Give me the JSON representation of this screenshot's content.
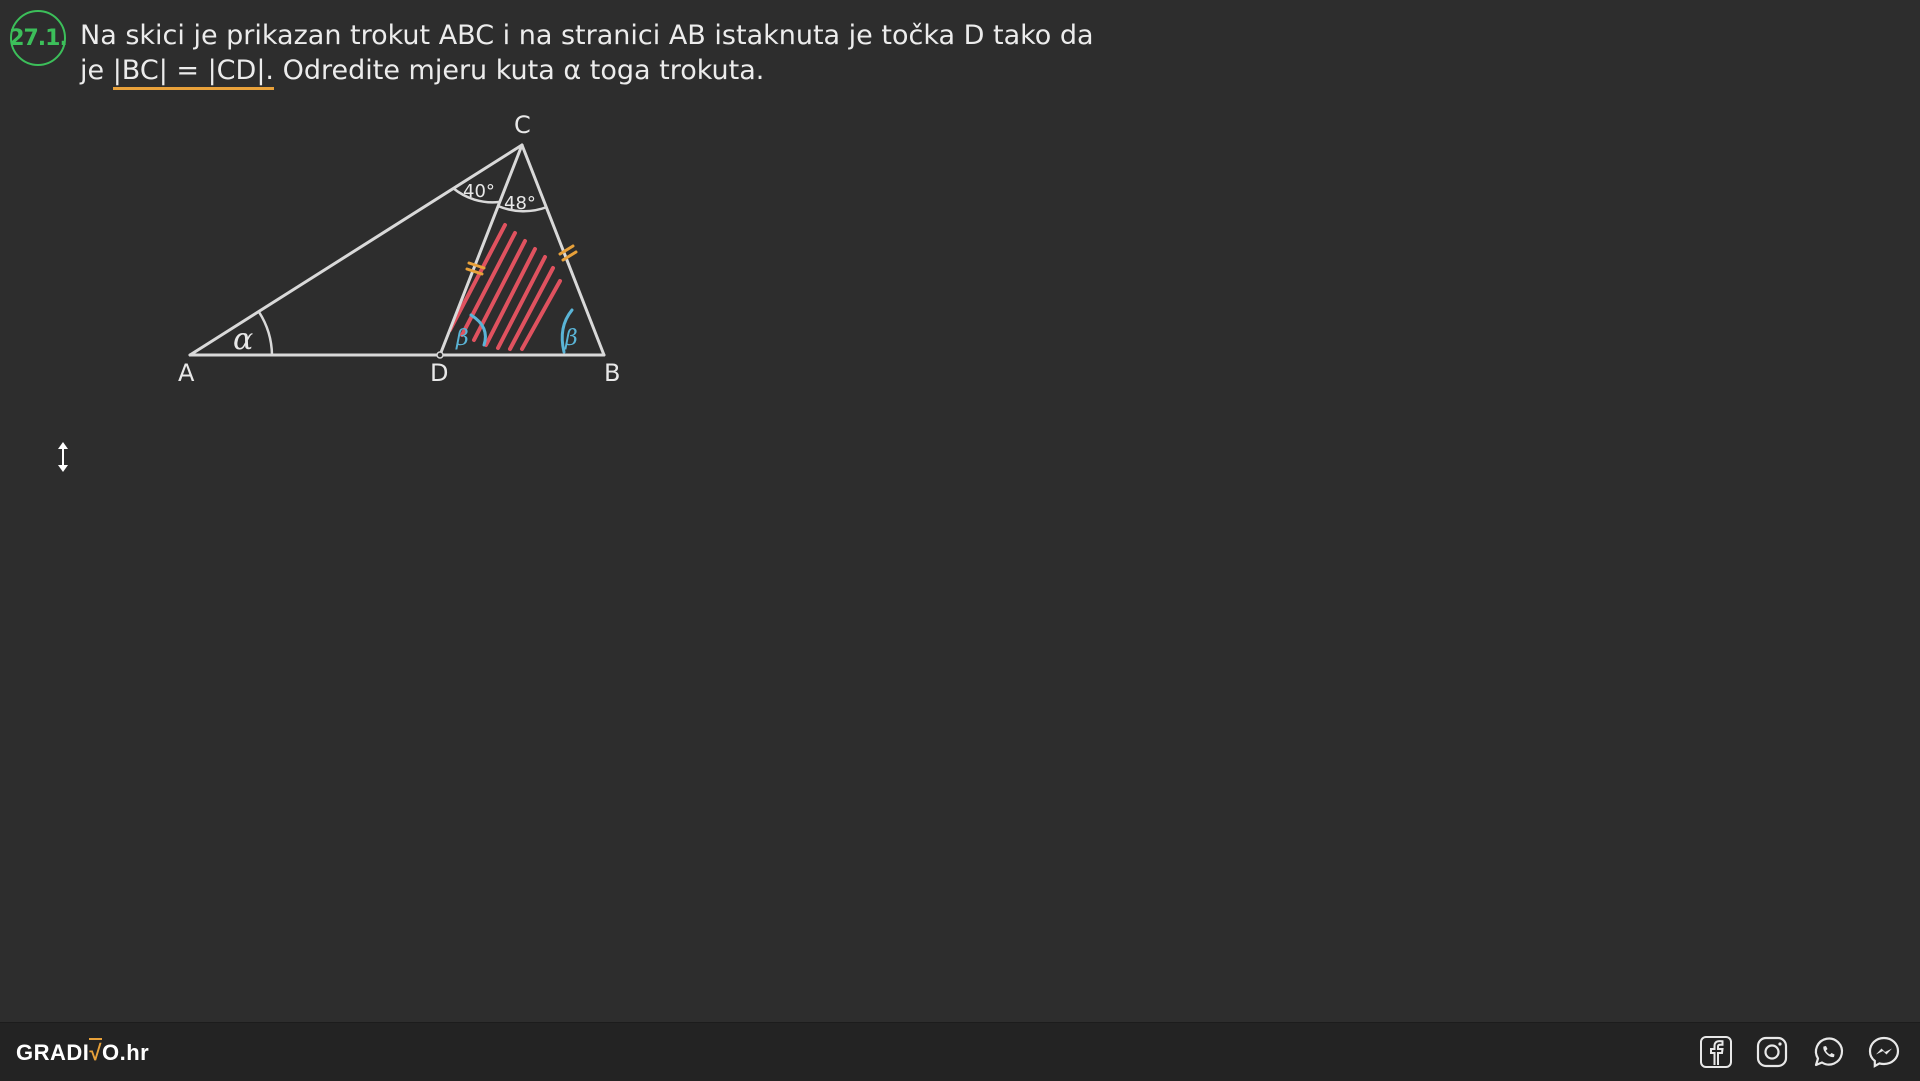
{
  "task": {
    "number": "27.1.",
    "line1": "Na skici je prikazan trokut ABC i na stranici AB istaknuta je točka D tako da",
    "line2_prefix": "je ",
    "line2_condition": "|BC| = |CD|.",
    "line2_suffix": " Odredite mjeru kuta α toga trokuta."
  },
  "figure": {
    "vertices": {
      "A": "A",
      "B": "B",
      "C": "C",
      "D": "D"
    },
    "angle_alpha": "α",
    "angle_ACD": "40°",
    "angle_DCB": "48°",
    "angle_beta_D": "β",
    "angle_beta_B": "β",
    "colors": {
      "lines": "#d9d9d9",
      "hatch": "#e0525f",
      "tick_marks": "#e8a13a",
      "beta": "#5ab4d6",
      "badge": "#3cbf5a"
    }
  },
  "footer": {
    "logo_left": "GRADI",
    "logo_root": "√",
    "logo_right": "O.hr",
    "social_icons": [
      "facebook-icon",
      "instagram-icon",
      "whatsapp-icon",
      "messenger-icon"
    ]
  }
}
